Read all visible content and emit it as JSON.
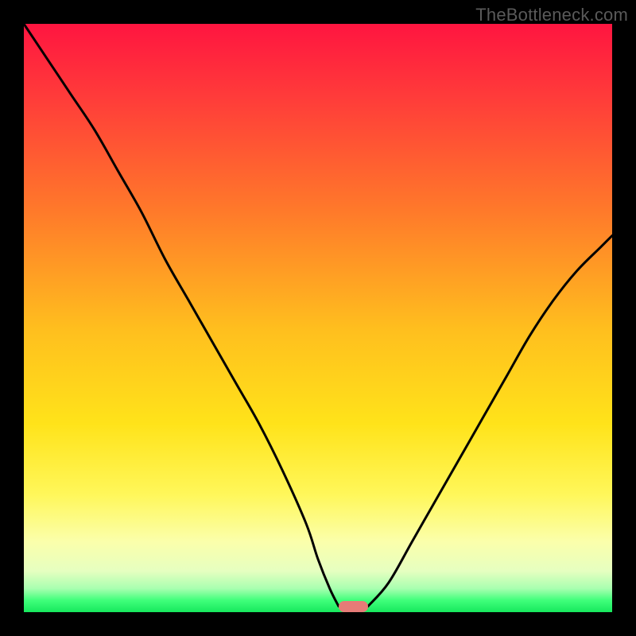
{
  "watermark": "TheBottleneck.com",
  "colors": {
    "top": "#ff1a3f",
    "mid_upper": "#ff6a2e",
    "mid": "#ffd21a",
    "mid_lower": "#fffb84",
    "lower_band": "#f7ffb8",
    "green": "#18ff5d",
    "curve": "#000000",
    "marker": "#e67b77",
    "watermark_text": "#5a5a5a"
  },
  "chart_data": {
    "type": "line",
    "title": "",
    "xlabel": "",
    "ylabel": "",
    "xlim": [
      0,
      100
    ],
    "ylim": [
      0,
      100
    ],
    "grid": false,
    "series": [
      {
        "name": "left-branch",
        "x": [
          0,
          4,
          8,
          12,
          16,
          20,
          24,
          28,
          32,
          36,
          40,
          44,
          48,
          50,
          52,
          53.5
        ],
        "values": [
          100,
          94,
          88,
          82,
          75,
          68,
          60,
          53,
          46,
          39,
          32,
          24,
          15,
          9,
          4,
          1
        ]
      },
      {
        "name": "right-branch",
        "x": [
          58.5,
          62,
          66,
          70,
          74,
          78,
          82,
          86,
          90,
          94,
          98,
          100
        ],
        "values": [
          1,
          5,
          12,
          19,
          26,
          33,
          40,
          47,
          53,
          58,
          62,
          64
        ]
      }
    ],
    "marker": {
      "x_center": 56,
      "x_width": 5,
      "y": 1
    }
  }
}
